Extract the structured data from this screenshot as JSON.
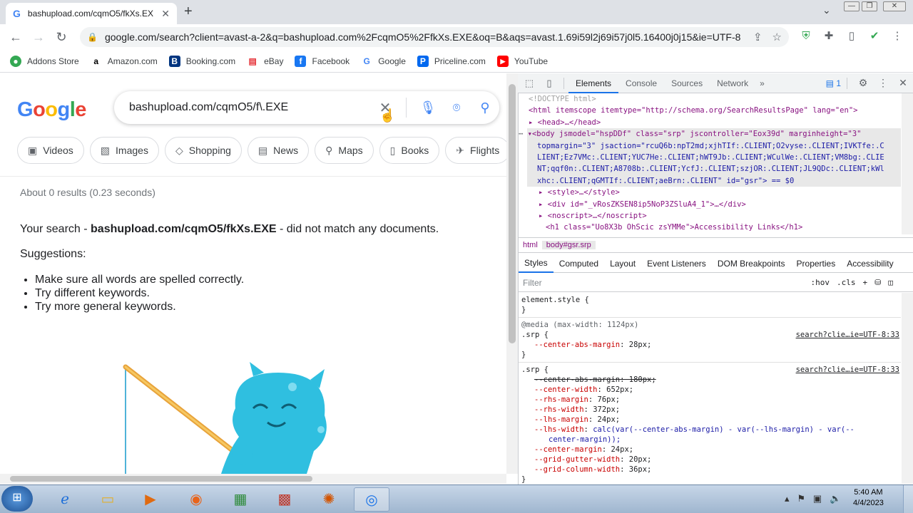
{
  "browser": {
    "tab_title": "bashupload.com/cqmO5/fkXs.EX",
    "url": "google.com/search?client=avast-a-2&q=bashupload.com%2FcqmO5%2FfkXs.EXE&oq=B&aqs=avast.1.69i59l2j69i57j0l5.16400j0j15&ie=UTF-8",
    "bookmarks": [
      {
        "label": "Addons Store",
        "icon": "addons-icon",
        "color": "#34a853"
      },
      {
        "label": "Amazon.com",
        "icon": "amazon-icon",
        "color": "#000000"
      },
      {
        "label": "Booking.com",
        "icon": "booking-icon",
        "color": "#003580"
      },
      {
        "label": "eBay",
        "icon": "ebay-icon",
        "color": "#e53238"
      },
      {
        "label": "Facebook",
        "icon": "facebook-icon",
        "color": "#1877f2"
      },
      {
        "label": "Google",
        "icon": "google-icon",
        "color": "#4285f4"
      },
      {
        "label": "Priceline.com",
        "icon": "priceline-icon",
        "color": "#0068ef"
      },
      {
        "label": "YouTube",
        "icon": "youtube-icon",
        "color": "#ff0000"
      }
    ]
  },
  "google": {
    "logo": "Google",
    "query": "bashupload.com/cqmO5/f\\.EXE",
    "chips": [
      "Videos",
      "Images",
      "Shopping",
      "News",
      "Maps",
      "Books",
      "Flights"
    ],
    "stats": "About 0 results (0.23 seconds)",
    "nomatch_prefix": "Your search - ",
    "nomatch_query": "bashupload.com/cqmO5/fkXs.EXE",
    "nomatch_suffix": " - did not match any documents.",
    "suggestions_title": "Suggestions:",
    "suggestions": [
      "Make sure all words are spelled correctly.",
      "Try different keywords.",
      "Try more general keywords."
    ]
  },
  "devtools": {
    "tabs": [
      "Elements",
      "Console",
      "Sources",
      "Network"
    ],
    "active_tab": "Elements",
    "issues_count": "1",
    "dom_lines": {
      "doctype": "<!DOCTYPE html>",
      "html_open": "<html itemscope itemtype=\"http://schema.org/SearchResultsPage\" lang=\"en\">",
      "head": "<head>…</head>",
      "body_1": "<body jsmodel=\"hspDDf\" class=\"srp\" jscontroller=\"Eox39d\" marginheight=\"3\"",
      "body_2": "topmargin=\"3\" jsaction=\"rcuQ6b:npT2md;xjhTIf:.CLIENT;O2vyse:.CLIENT;IVKTfe:.C",
      "body_3": "LIENT;Ez7VMc:.CLIENT;YUC7He:.CLIENT;hWT9Jb:.CLIENT;WCulWe:.CLIENT;VM8bg:.CLIE",
      "body_4": "NT;qqf0n:.CLIENT;A8708b:.CLIENT;YcfJ:.CLIENT;szjOR:.CLIENT;JL9QDc:.CLIENT;kWl",
      "body_5": "xhc:.CLIENT;qGMTIf:.CLIENT;aeBrn:.CLIENT\" id=\"gsr\"> == $0",
      "style": "<style>…</style>",
      "div": "<div id=\"_vRosZKSEN8ip5NoP3ZSluA4_1\">…</div>",
      "noscript": "<noscript>…</noscript>",
      "h1": "<h1 class=\"Uo8X3b OhScic zsYMMe\">Accessibility Links</h1>"
    },
    "breadcrumbs": [
      "html",
      "body#gsr.srp"
    ],
    "subtabs": [
      "Styles",
      "Computed",
      "Layout",
      "Event Listeners",
      "DOM Breakpoints",
      "Properties",
      "Accessibility"
    ],
    "filter_placeholder": "Filter",
    "filter_hov": ":hov",
    "filter_cls": ".cls",
    "styles": {
      "element_style": "element.style {",
      "close": "}",
      "media": "@media (max-width: 1124px)",
      "srp": ".srp {",
      "source": "search?clie…ie=UTF-8:33",
      "rule1": [
        {
          "name": "--center-abs-margin",
          "value": "28px;"
        }
      ],
      "rule2_strike": "--center-abs-margin: 180px;",
      "rule2": [
        {
          "name": "--center-width",
          "value": "652px;"
        },
        {
          "name": "--rhs-margin",
          "value": "76px;"
        },
        {
          "name": "--rhs-width",
          "value": "372px;"
        },
        {
          "name": "--lhs-margin",
          "value": "24px;"
        },
        {
          "name": "--lhs-width",
          "value": "calc(var(--center-abs-margin) - var(--lhs-margin) - var(--"
        },
        {
          "name": "",
          "value": "center-margin));"
        },
        {
          "name": "--center-margin",
          "value": "24px;"
        },
        {
          "name": "--grid-gutter-width",
          "value": "20px;"
        },
        {
          "name": "--grid-column-width",
          "value": "36px;"
        }
      ]
    }
  },
  "taskbar": {
    "time": "5:40 AM",
    "date": "4/4/2023"
  }
}
